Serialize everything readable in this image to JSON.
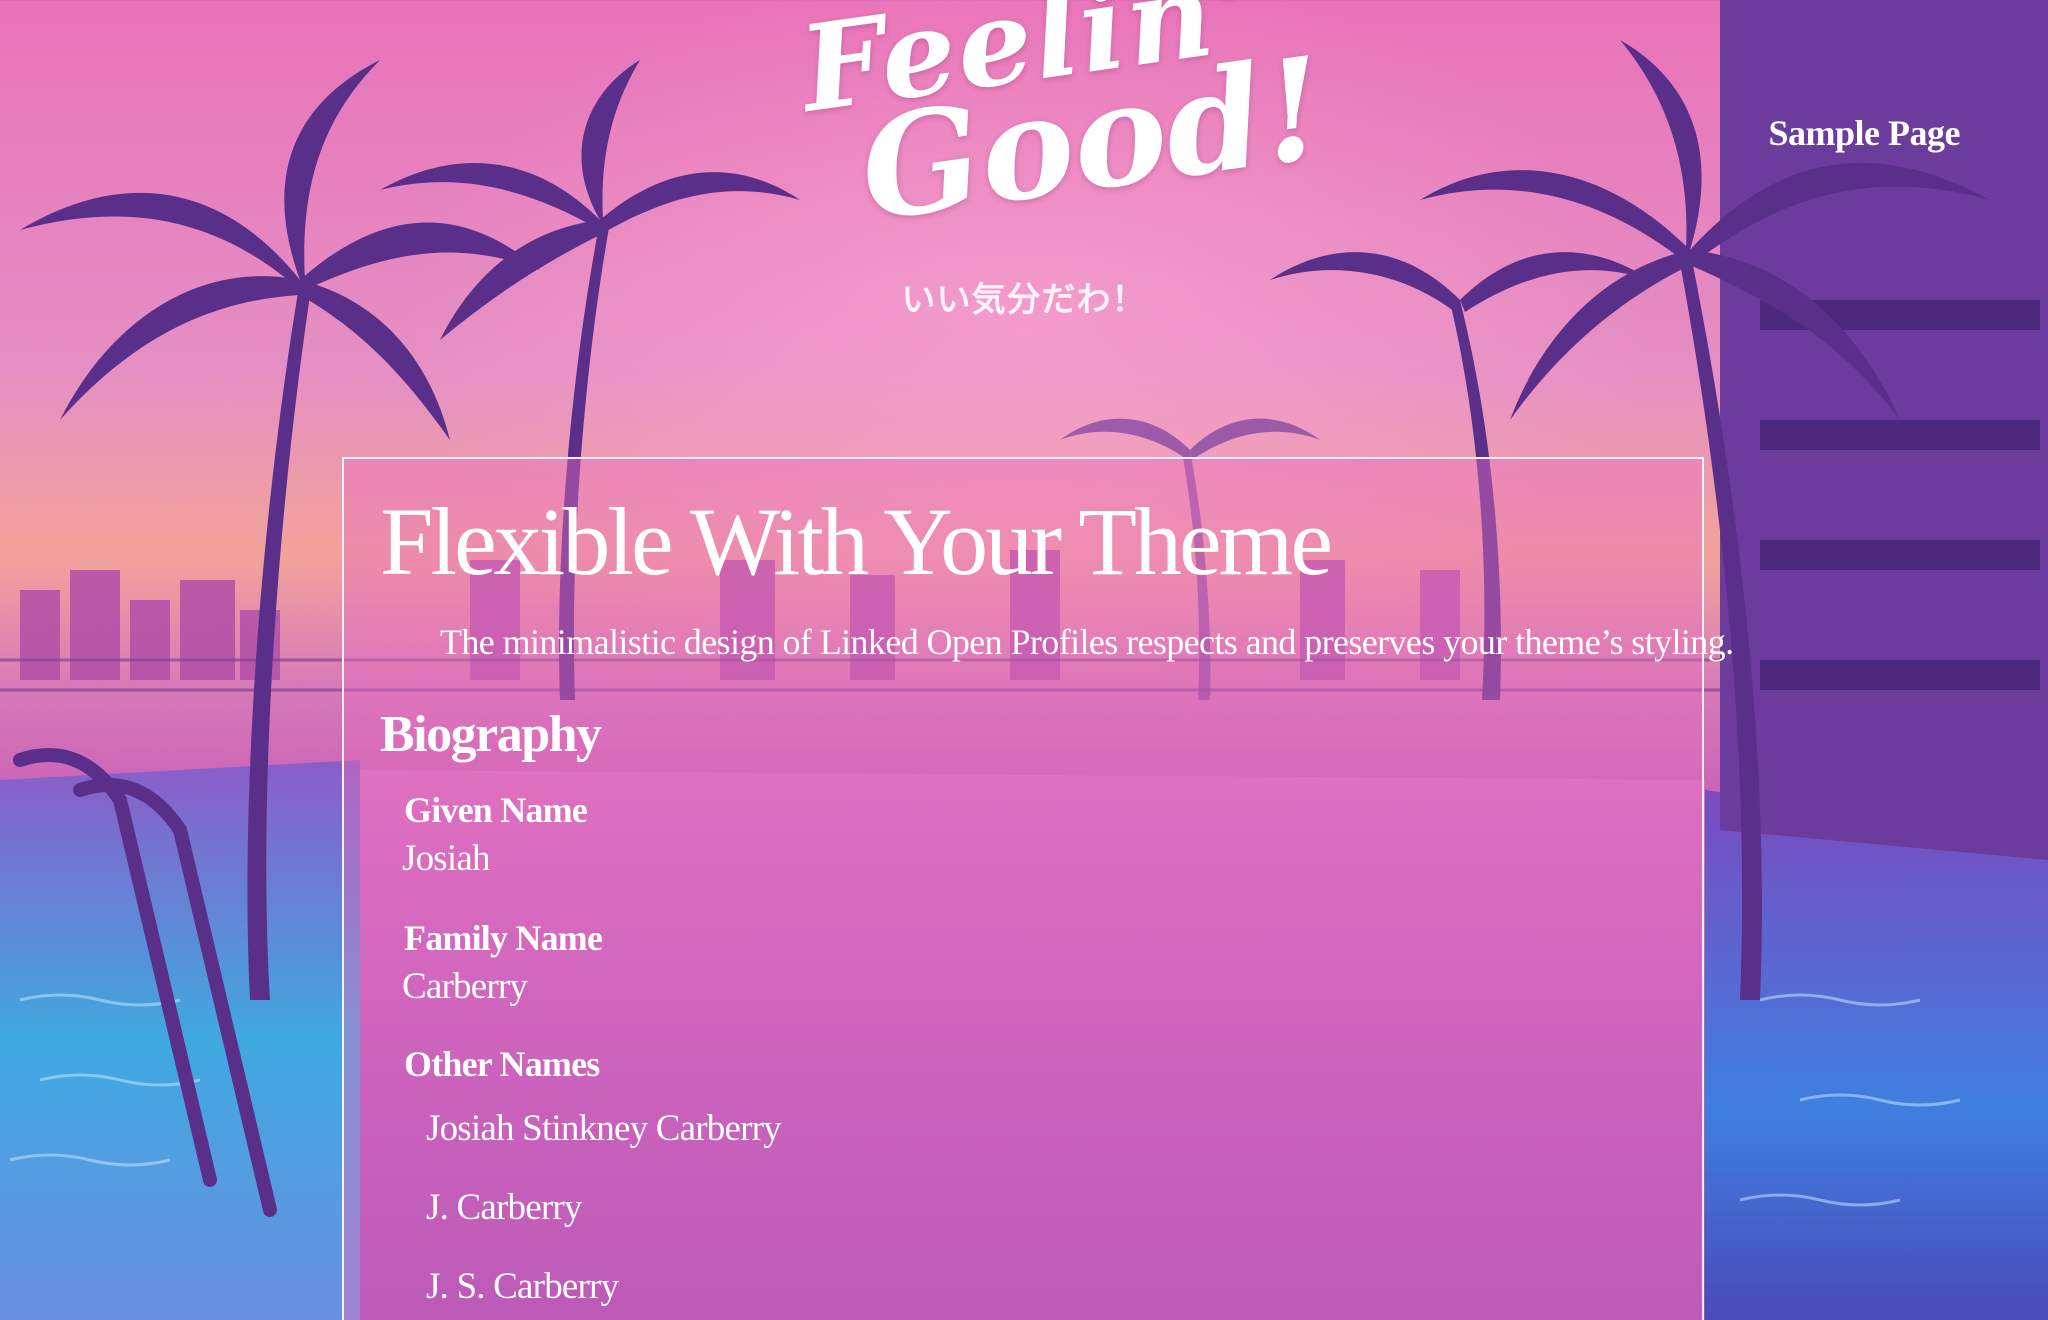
{
  "site": {
    "logo_line1": "Feelin'",
    "logo_line2": "Good!",
    "tagline": "いい気分だわ！"
  },
  "nav": {
    "items": [
      {
        "label": "Sample Page"
      }
    ]
  },
  "content": {
    "title": "Flexible With Your Theme",
    "intro": "The minimalistic design of Linked Open Profiles respects and preserves your theme’s styling.",
    "section_heading": "Biography",
    "fields": {
      "given_name": {
        "label": "Given Name",
        "value": "Josiah"
      },
      "family_name": {
        "label": "Family Name",
        "value": "Carberry"
      },
      "other_names": {
        "label": "Other Names",
        "values": [
          "Josiah Stinkney Carberry",
          "J. Carberry",
          "J. S. Carberry"
        ]
      }
    }
  },
  "colors": {
    "sky_pink": "#e873b8",
    "sunset_orange": "#f2a39a",
    "pool_blue": "#3fa9e0",
    "silhouette_purple": "#5a2f8a",
    "panel_border": "#ffffff"
  },
  "decorations": [
    "palm-tree-silhouettes",
    "pool-water",
    "city-skyline",
    "hotel-building",
    "pool-ladder"
  ]
}
